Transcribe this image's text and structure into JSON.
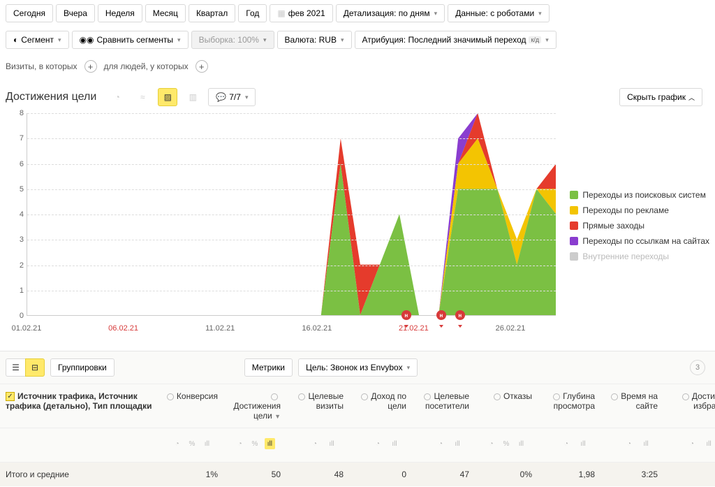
{
  "periods": {
    "today": "Сегодня",
    "yesterday": "Вчера",
    "week": "Неделя",
    "month": "Месяц",
    "quarter": "Квартал",
    "year": "Год",
    "picker": "фев 2021"
  },
  "top_selects": {
    "detail": "Детализация: по дням",
    "data": "Данные: с роботами"
  },
  "row2": {
    "segment": "Сегмент",
    "compare": "Сравнить сегменты",
    "sample": "Выборка: 100%",
    "currency": "Валюта: RUB",
    "attribution": "Атрибуция: Последний значимый переход",
    "attr_badge": "к/д"
  },
  "filters": {
    "visits": "Визиты, в которых",
    "people": "для людей, у которых"
  },
  "section": {
    "title": "Достижения цели",
    "counter": "7/7",
    "hide": "Скрыть график"
  },
  "chart_data": {
    "type": "area",
    "ylim": [
      0,
      8
    ],
    "yticks": [
      0,
      1,
      2,
      3,
      4,
      5,
      6,
      7,
      8
    ],
    "xticks": [
      {
        "label": "01.02.21",
        "pos": 0
      },
      {
        "label": "06.02.21",
        "pos": 18,
        "red": true
      },
      {
        "label": "11.02.21",
        "pos": 36
      },
      {
        "label": "16.02.21",
        "pos": 54
      },
      {
        "label": "21.02.21",
        "pos": 72,
        "red": true
      },
      {
        "label": "26.02.21",
        "pos": 90
      }
    ],
    "dates": [
      "01.02.21",
      "02.02.21",
      "03.02.21",
      "04.02.21",
      "05.02.21",
      "06.02.21",
      "07.02.21",
      "08.02.21",
      "09.02.21",
      "10.02.21",
      "11.02.21",
      "12.02.21",
      "13.02.21",
      "14.02.21",
      "15.02.21",
      "16.02.21",
      "17.02.21",
      "18.02.21",
      "19.02.21",
      "20.02.21",
      "21.02.21",
      "22.02.21",
      "23.02.21",
      "24.02.21",
      "25.02.21",
      "26.02.21",
      "27.02.21",
      "28.02.21"
    ],
    "series": [
      {
        "name": "Переходы из поисковых систем",
        "color": "#7bc043",
        "values": [
          0,
          0,
          0,
          0,
          0,
          0,
          0,
          0,
          0,
          0,
          0,
          0,
          0,
          0,
          0,
          0,
          6,
          0,
          2,
          4,
          0,
          0,
          5,
          5,
          5,
          2,
          5,
          4
        ]
      },
      {
        "name": "Переходы по рекламе",
        "color": "#f3c402",
        "values": [
          0,
          0,
          0,
          0,
          0,
          0,
          0,
          0,
          0,
          0,
          0,
          0,
          0,
          0,
          0,
          0,
          0,
          0,
          0,
          0,
          0,
          0,
          1,
          2,
          0,
          1,
          0,
          1
        ]
      },
      {
        "name": "Прямые заходы",
        "color": "#e53b2c",
        "values": [
          0,
          0,
          0,
          0,
          0,
          0,
          0,
          0,
          0,
          0,
          0,
          0,
          0,
          0,
          0,
          0,
          1,
          2,
          0,
          0,
          0,
          0,
          0,
          1,
          0,
          0,
          0,
          1
        ]
      },
      {
        "name": "Переходы по ссылкам на сайтах",
        "color": "#8a3dcf",
        "values": [
          0,
          0,
          0,
          0,
          0,
          0,
          0,
          0,
          0,
          0,
          0,
          0,
          0,
          0,
          0,
          0,
          0,
          0,
          0,
          0,
          0,
          0,
          1,
          0,
          0,
          0,
          0,
          0
        ]
      },
      {
        "name": "Внутренние переходы",
        "color": "#cccccc",
        "values": [
          0,
          0,
          0,
          0,
          0,
          0,
          0,
          0,
          0,
          0,
          0,
          0,
          0,
          0,
          0,
          0,
          0,
          0,
          0,
          0,
          0,
          0,
          0,
          0,
          0,
          0,
          0,
          0
        ],
        "disabled": true
      }
    ],
    "markers_h": [
      70.5,
      77,
      80.5
    ]
  },
  "table_toolbar": {
    "groupings": "Группировки",
    "metrics": "Метрики",
    "goal": "Цель: Звонок из Envybox",
    "badge": "3"
  },
  "table": {
    "dim_header": "Источник трафика, Источник трафика (детально), Тип площадки",
    "cols": [
      "Конверсия",
      "Достижения цели",
      "Целевые визиты",
      "Доход по цели",
      "Целевые посетители",
      "Отказы",
      "Глубина просмотра",
      "Время на сайте",
      "Достиж избран"
    ],
    "sort_col": 1,
    "totals_label": "Итого и средние",
    "totals": [
      "1%",
      "50",
      "48",
      "0",
      "47",
      "0%",
      "1,98",
      "3:25",
      ""
    ]
  }
}
